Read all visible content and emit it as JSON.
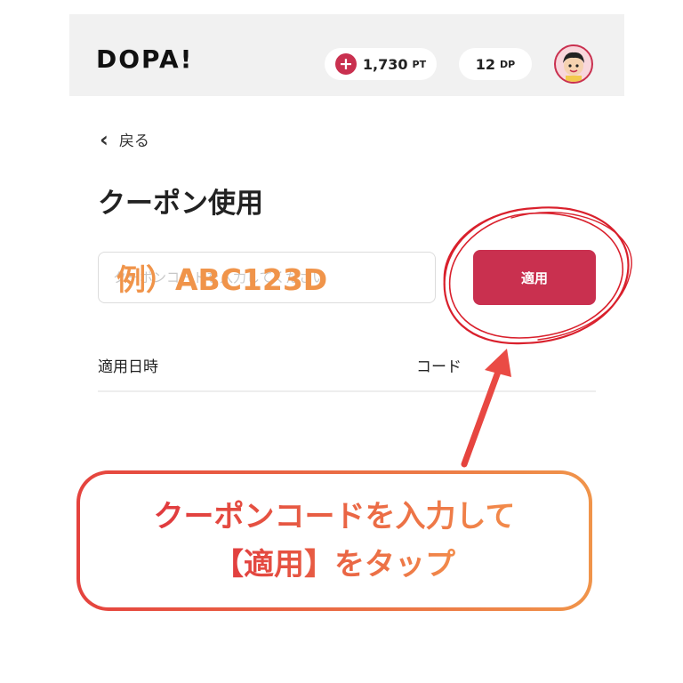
{
  "header": {
    "logo": "DOPA!",
    "points": {
      "value": "1,730",
      "unit": "PT",
      "icon": "plus-icon"
    },
    "dopa_points": {
      "value": "12",
      "unit": "DP"
    },
    "avatar": "user-avatar"
  },
  "nav": {
    "back_label": "戻る",
    "back_icon": "chevron-left-icon"
  },
  "page": {
    "title": "クーポン使用"
  },
  "coupon_form": {
    "placeholder": "クーポンコードを入力してください",
    "example_overlay": "例）ABC123D",
    "apply_label": "適用"
  },
  "history_table": {
    "columns": [
      "適用日時",
      "コード"
    ],
    "rows": []
  },
  "annotation": {
    "lines": [
      "クーポンコードを入力して",
      "【適用】をタップ"
    ],
    "colors": {
      "start": "#e5433e",
      "end": "#f0944a",
      "circle": "#d9202c"
    }
  },
  "colors": {
    "accent": "#c9304f",
    "header_bg": "#f1f1f1",
    "example_text": "#f0944a"
  }
}
